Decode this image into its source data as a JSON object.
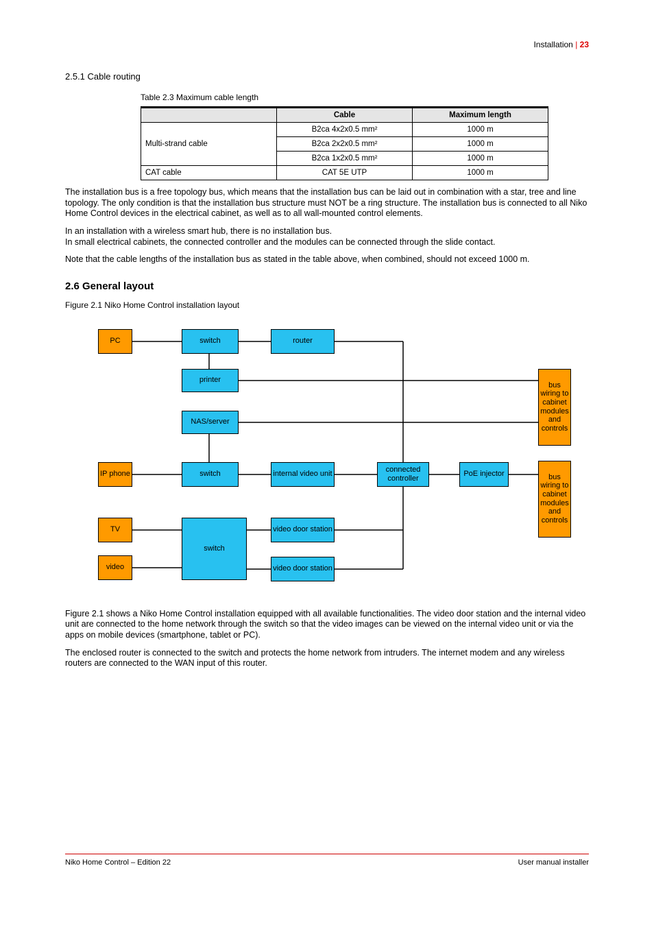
{
  "header": {
    "chapter": "Installation",
    "page": "23"
  },
  "section_heading": "2.5.1  Cable routing",
  "table_caption": "Table 2.3  Maximum cable length",
  "table": {
    "headers": [
      "",
      "Cable",
      "Maximum length"
    ],
    "rows": [
      {
        "c0": "Multi-strand cable",
        "c1": "B2ca 4x2x0.5 mm²",
        "c2": "1000 m",
        "rowspan": 3
      },
      {
        "c1": "B2ca 2x2x0.5 mm²",
        "c2": "1000 m"
      },
      {
        "c1": "B2ca 1x2x0.5 mm²",
        "c2": "1000 m"
      },
      {
        "c0": "CAT cable",
        "c1": "CAT 5E UTP",
        "c2": "1000 m",
        "rowspan": 1
      }
    ]
  },
  "text": {
    "p1": "The installation bus is a free topology bus, which means that the installation bus can be laid out in combination with a star, tree and line topology. The only condition is that the installation bus structure must NOT be a ring structure. The installation bus is connected to all Niko Home Control devices in the electrical cabinet, as well as to all wall-mounted control elements.",
    "p2_a": "In an installation with a wireless smart hub, there is no installation bus.",
    "p2_b": "In small electrical cabinets, the connected controller and the modules can be connected through the slide contact.",
    "p3": "Note that the cable lengths of the installation bus as stated in the table above, when combined, should not exceed 1000 m."
  },
  "heading2": "2.6  General layout",
  "figure_caption": "Figure 2.1  Niko Home Control installation layout",
  "diagram": {
    "nodes": {
      "pc": "PC",
      "switch": "switch",
      "router": "router",
      "printer": "printer",
      "nas": "NAS/server",
      "phone": "IP phone",
      "dvs1": "video door station",
      "dvs2": "video door station",
      "tv": "TV",
      "video": "video",
      "vds": "internal video unit",
      "cc": "connected controller",
      "poe": "PoE injector",
      "ext1": "bus wiring to cabinet modules and controls",
      "ext2": "bus wiring to cabinet modules and controls"
    }
  },
  "text2": {
    "p4": "Figure 2.1 shows a Niko Home Control installation equipped with all available functionalities. The video door station and the internal video unit are connected to the home network through the switch so that the video images can be viewed on the internal video unit or via the apps on mobile devices (smartphone, tablet or PC).",
    "p5": "The enclosed router is connected to the switch and protects the home network from intruders. The internet modem and any wireless routers are connected to the WAN input of this router."
  },
  "footer": {
    "left": "Niko Home Control – Edition 22",
    "right": "User manual installer"
  }
}
